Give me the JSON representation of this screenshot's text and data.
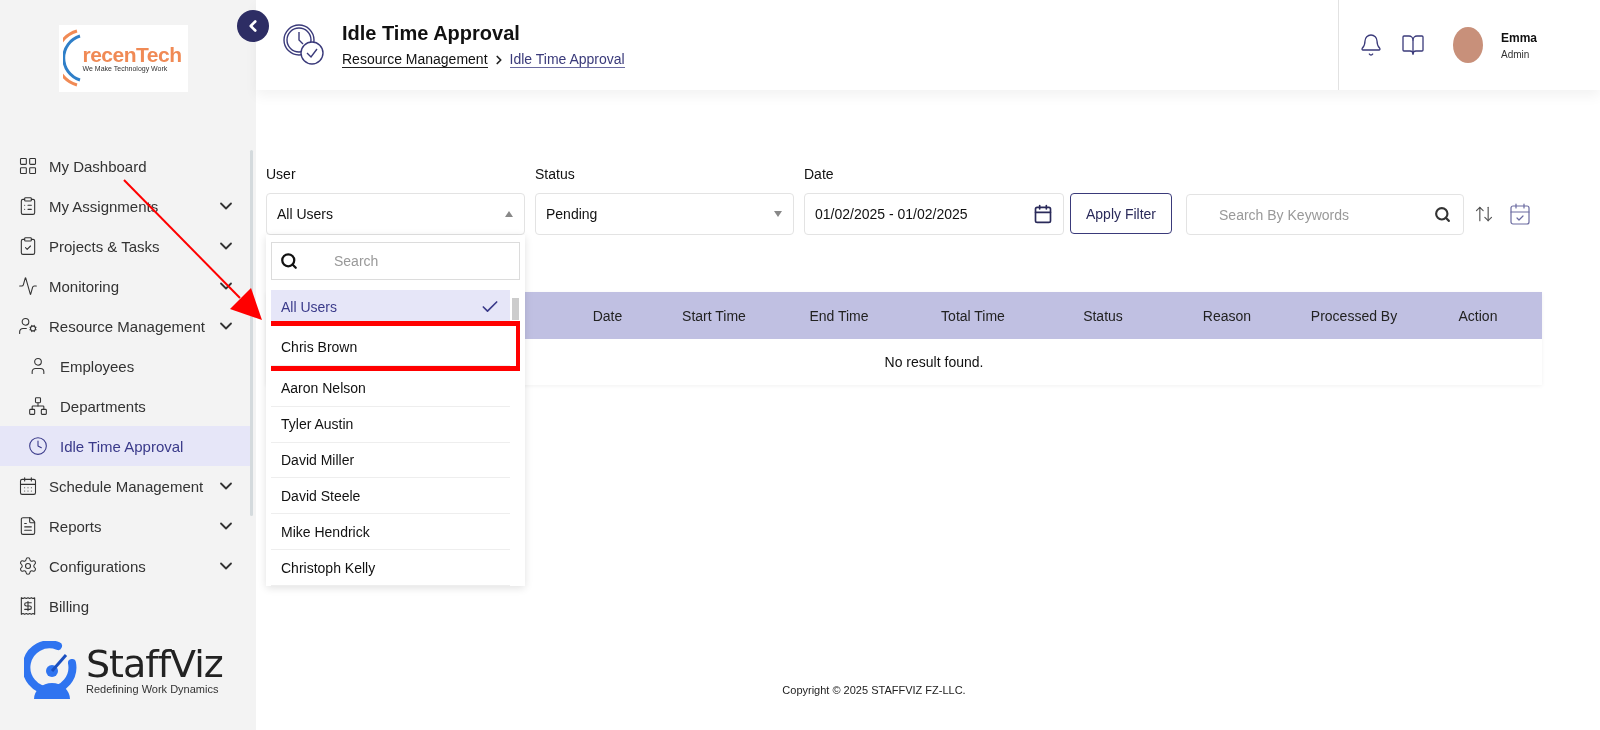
{
  "brand": {
    "name": "recenTech",
    "tagline": "We Make Technology Work"
  },
  "sidebar": {
    "items": [
      {
        "label": "My Dashboard",
        "kind": "link",
        "selected": false
      },
      {
        "label": "My Assignments",
        "kind": "group",
        "selected": false
      },
      {
        "label": "Projects & Tasks",
        "kind": "group",
        "selected": false
      },
      {
        "label": "Monitoring",
        "kind": "group",
        "selected": false
      },
      {
        "label": "Resource Management",
        "kind": "group",
        "selected": false,
        "children": [
          {
            "label": "Employees",
            "selected": false
          },
          {
            "label": "Departments",
            "selected": false
          },
          {
            "label": "Idle Time Approval",
            "selected": true
          }
        ]
      },
      {
        "label": "Schedule Management",
        "kind": "group",
        "selected": false
      },
      {
        "label": "Reports",
        "kind": "group",
        "selected": false
      },
      {
        "label": "Configurations",
        "kind": "group",
        "selected": false
      },
      {
        "label": "Billing",
        "kind": "link",
        "selected": false
      }
    ]
  },
  "footer_brand": {
    "name": "StaffViz",
    "tagline": "Redefining Work Dynamics"
  },
  "header": {
    "title": "Idle Time Approval",
    "breadcrumb": [
      {
        "label": "Resource Management",
        "current": false
      },
      {
        "label": "Idle Time Approval",
        "current": true
      }
    ],
    "user": {
      "name": "Emma",
      "role": "Admin"
    }
  },
  "filters": {
    "user": {
      "label": "User",
      "value": "All Users",
      "open": true,
      "search_placeholder": "Search",
      "options": [
        {
          "label": "All Users",
          "selected": true,
          "highlighted": false
        },
        {
          "label": "Chris Brown",
          "selected": false,
          "highlighted": true
        },
        {
          "label": "Aaron Nelson",
          "selected": false,
          "highlighted": false
        },
        {
          "label": "Tyler Austin",
          "selected": false,
          "highlighted": false
        },
        {
          "label": "David Miller",
          "selected": false,
          "highlighted": false
        },
        {
          "label": "David Steele",
          "selected": false,
          "highlighted": false
        },
        {
          "label": "Mike Hendrick",
          "selected": false,
          "highlighted": false
        },
        {
          "label": "Christoph Kelly",
          "selected": false,
          "highlighted": false
        }
      ]
    },
    "status": {
      "label": "Status",
      "value": "Pending"
    },
    "date": {
      "label": "Date",
      "value": "01/02/2025 - 01/02/2025"
    },
    "apply_button": "Apply Filter",
    "search": {
      "placeholder": "Search By Keywords"
    }
  },
  "table": {
    "columns": [
      "Date",
      "Start Time",
      "End Time",
      "Total Time",
      "Status",
      "Reason",
      "Processed By",
      "Action"
    ],
    "empty_message": "No result found."
  },
  "annotation": {
    "arrow": true
  },
  "copyright": "Copyright © 2025 STAFFVIZ FZ-LLC."
}
